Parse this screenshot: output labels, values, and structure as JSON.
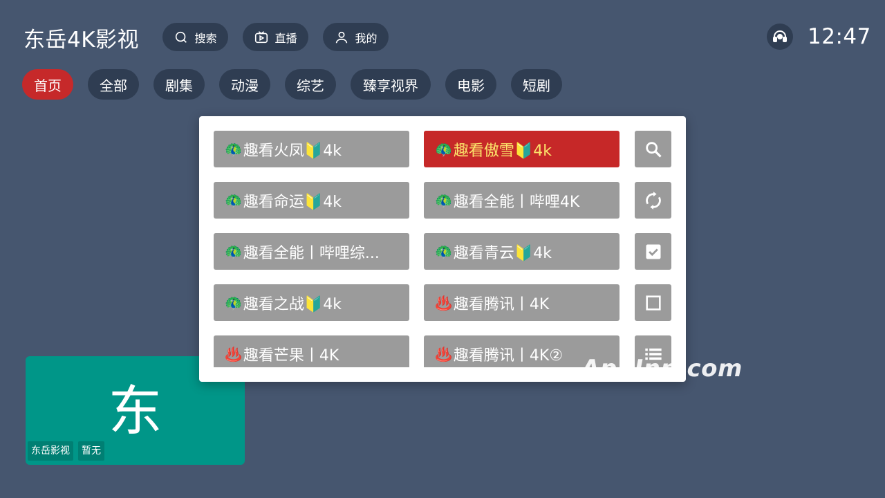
{
  "app": {
    "title": "东岳4K影视",
    "clock": "12:47"
  },
  "header": {
    "search_label": "搜索",
    "live_label": "直播",
    "mine_label": "我的"
  },
  "categories": [
    "首页",
    "全部",
    "剧集",
    "动漫",
    "综艺",
    "臻享视界",
    "电影",
    "短剧"
  ],
  "active_category": "首页",
  "tile": {
    "char": "东",
    "tag1": "东岳影视",
    "tag2": "暂无"
  },
  "sources": {
    "left": [
      {
        "emoji": "🦚",
        "label": "趣看火凤🔰4k"
      },
      {
        "emoji": "🦚",
        "label": "趣看命运🔰4k"
      },
      {
        "emoji": "🦚",
        "label": "趣看全能丨哔哩综..."
      },
      {
        "emoji": "🦚",
        "label": "趣看之战🔰4k"
      },
      {
        "emoji": "♨️",
        "label": "趣看芒果丨4K"
      }
    ],
    "right": [
      {
        "emoji": "🦚",
        "label": "趣看傲雪🔰4k"
      },
      {
        "emoji": "🦚",
        "label": "趣看全能丨哔哩4K"
      },
      {
        "emoji": "🦚",
        "label": "趣看青云🔰4k"
      },
      {
        "emoji": "♨️",
        "label": "趣看腾讯丨4K"
      },
      {
        "emoji": "♨️",
        "label": "趣看腾讯丨4K②"
      }
    ],
    "selected": "趣看傲雪🔰4k"
  },
  "side_icons": [
    "search-icon",
    "refresh-icon",
    "checked-box-icon",
    "unchecked-box-icon",
    "list-icon"
  ],
  "colors": {
    "background": "#46566f",
    "pill": "#2f3d52",
    "accent": "#c62828",
    "selected_text": "#fbe36a",
    "item": "#9b9b9b",
    "tile": "#009688"
  },
  "watermark": "AppInn.com"
}
